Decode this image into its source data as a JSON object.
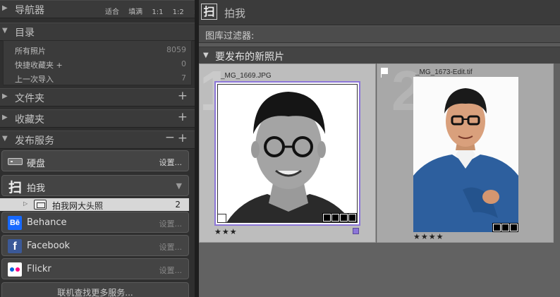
{
  "navigator": {
    "title": "导航器",
    "options": [
      "适合",
      "填满",
      "1:1",
      "1:2"
    ]
  },
  "catalog": {
    "title": "目录",
    "rows": [
      {
        "label": "所有照片",
        "count": "8059"
      },
      {
        "label": "快捷收藏夹 +",
        "count": "0"
      },
      {
        "label": "上一次导入",
        "count": "7"
      }
    ]
  },
  "folders": {
    "title": "文件夹"
  },
  "collections": {
    "title": "收藏夹"
  },
  "publish": {
    "title": "发布服务",
    "services": [
      {
        "name": "硬盘",
        "setup": "设置..."
      },
      {
        "name": "拍我"
      },
      {
        "name": "Behance",
        "setup": "设置..."
      },
      {
        "name": "Facebook",
        "setup": "设置..."
      },
      {
        "name": "Flickr",
        "setup": "设置..."
      }
    ],
    "collection": {
      "label": "拍我网大头照",
      "count": "2"
    },
    "more": "联机查找更多服务..."
  },
  "right": {
    "title": "拍我",
    "filter": "图库过滤器:",
    "section": "要发布的新照片",
    "photos": [
      {
        "index": "1",
        "filename": "_MG_1669.JPG",
        "rating": "★★★"
      },
      {
        "index": "2",
        "filename": "_MG_1673-Edit.tif",
        "rating": "★★★★"
      }
    ]
  },
  "colors": {
    "panel": "#2f2f2f",
    "selection": "#8c76d8",
    "facebook": "#3b5998",
    "behance": "#1769ff",
    "flickr_blue": "#0063dc",
    "flickr_pink": "#ff0084"
  }
}
